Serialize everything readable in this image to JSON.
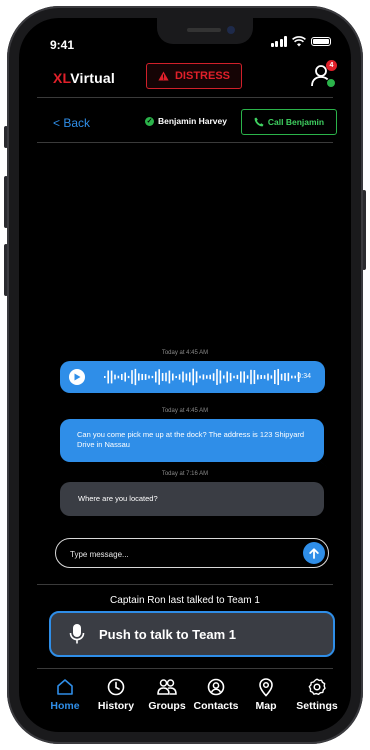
{
  "status_bar": {
    "time": "9:41"
  },
  "header": {
    "logo_prefix": "XL",
    "logo_suffix": "Virtual",
    "distress_label": "DISTRESS",
    "notification_count": "4"
  },
  "conversation": {
    "back_label": "< Back",
    "contact_name": "Benjamin Harvey",
    "call_label": "Call Benjamin"
  },
  "messages": [
    {
      "timestamp": "Today at 4:45 AM",
      "type": "voice",
      "duration": "0:34"
    },
    {
      "timestamp": "Today at 4:45 AM",
      "type": "text",
      "text": "Can you come pick me up at the dock? The address is 123 Shipyard Drive in Nassau"
    },
    {
      "timestamp": "Today at 7:16 AM",
      "type": "text",
      "text": "Where are you located?"
    }
  ],
  "composer": {
    "placeholder": "Type message..."
  },
  "ptt": {
    "last_talked": "Captain Ron last talked to Team 1",
    "button_label": "Push to talk to Team 1"
  },
  "nav": {
    "items": [
      {
        "label": "Home",
        "icon": "home-icon",
        "active": true
      },
      {
        "label": "History",
        "icon": "clock-icon"
      },
      {
        "label": "Groups",
        "icon": "group-icon"
      },
      {
        "label": "Contacts",
        "icon": "contact-icon"
      },
      {
        "label": "Map",
        "icon": "map-pin-icon"
      },
      {
        "label": "Settings",
        "icon": "gear-icon"
      }
    ]
  },
  "colors": {
    "accent": "#2f8ee8",
    "danger": "#e0202a",
    "success": "#2bb34a",
    "incoming_bubble": "#3a3d44",
    "background": "#000000"
  }
}
